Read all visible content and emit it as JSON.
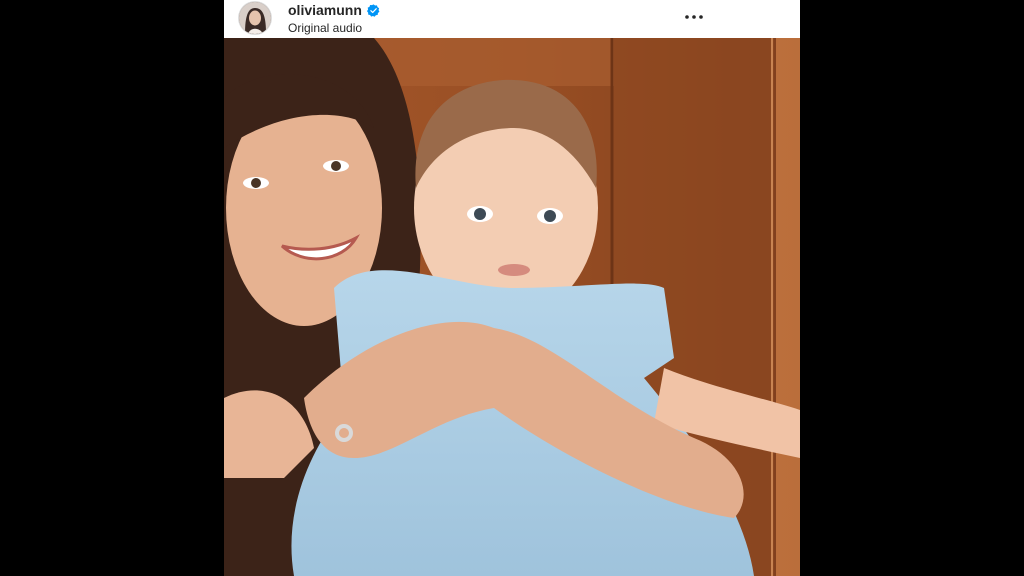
{
  "post": {
    "username": "oliviamunn",
    "audio_label": "Original audio",
    "verified": true,
    "menu_icon": "more-horizontal-icon",
    "verified_icon": "verified-badge-icon",
    "media_description_visible": false
  },
  "colors": {
    "verified_blue": "#0095f6",
    "text": "#262626",
    "backdrop": "#000000"
  }
}
